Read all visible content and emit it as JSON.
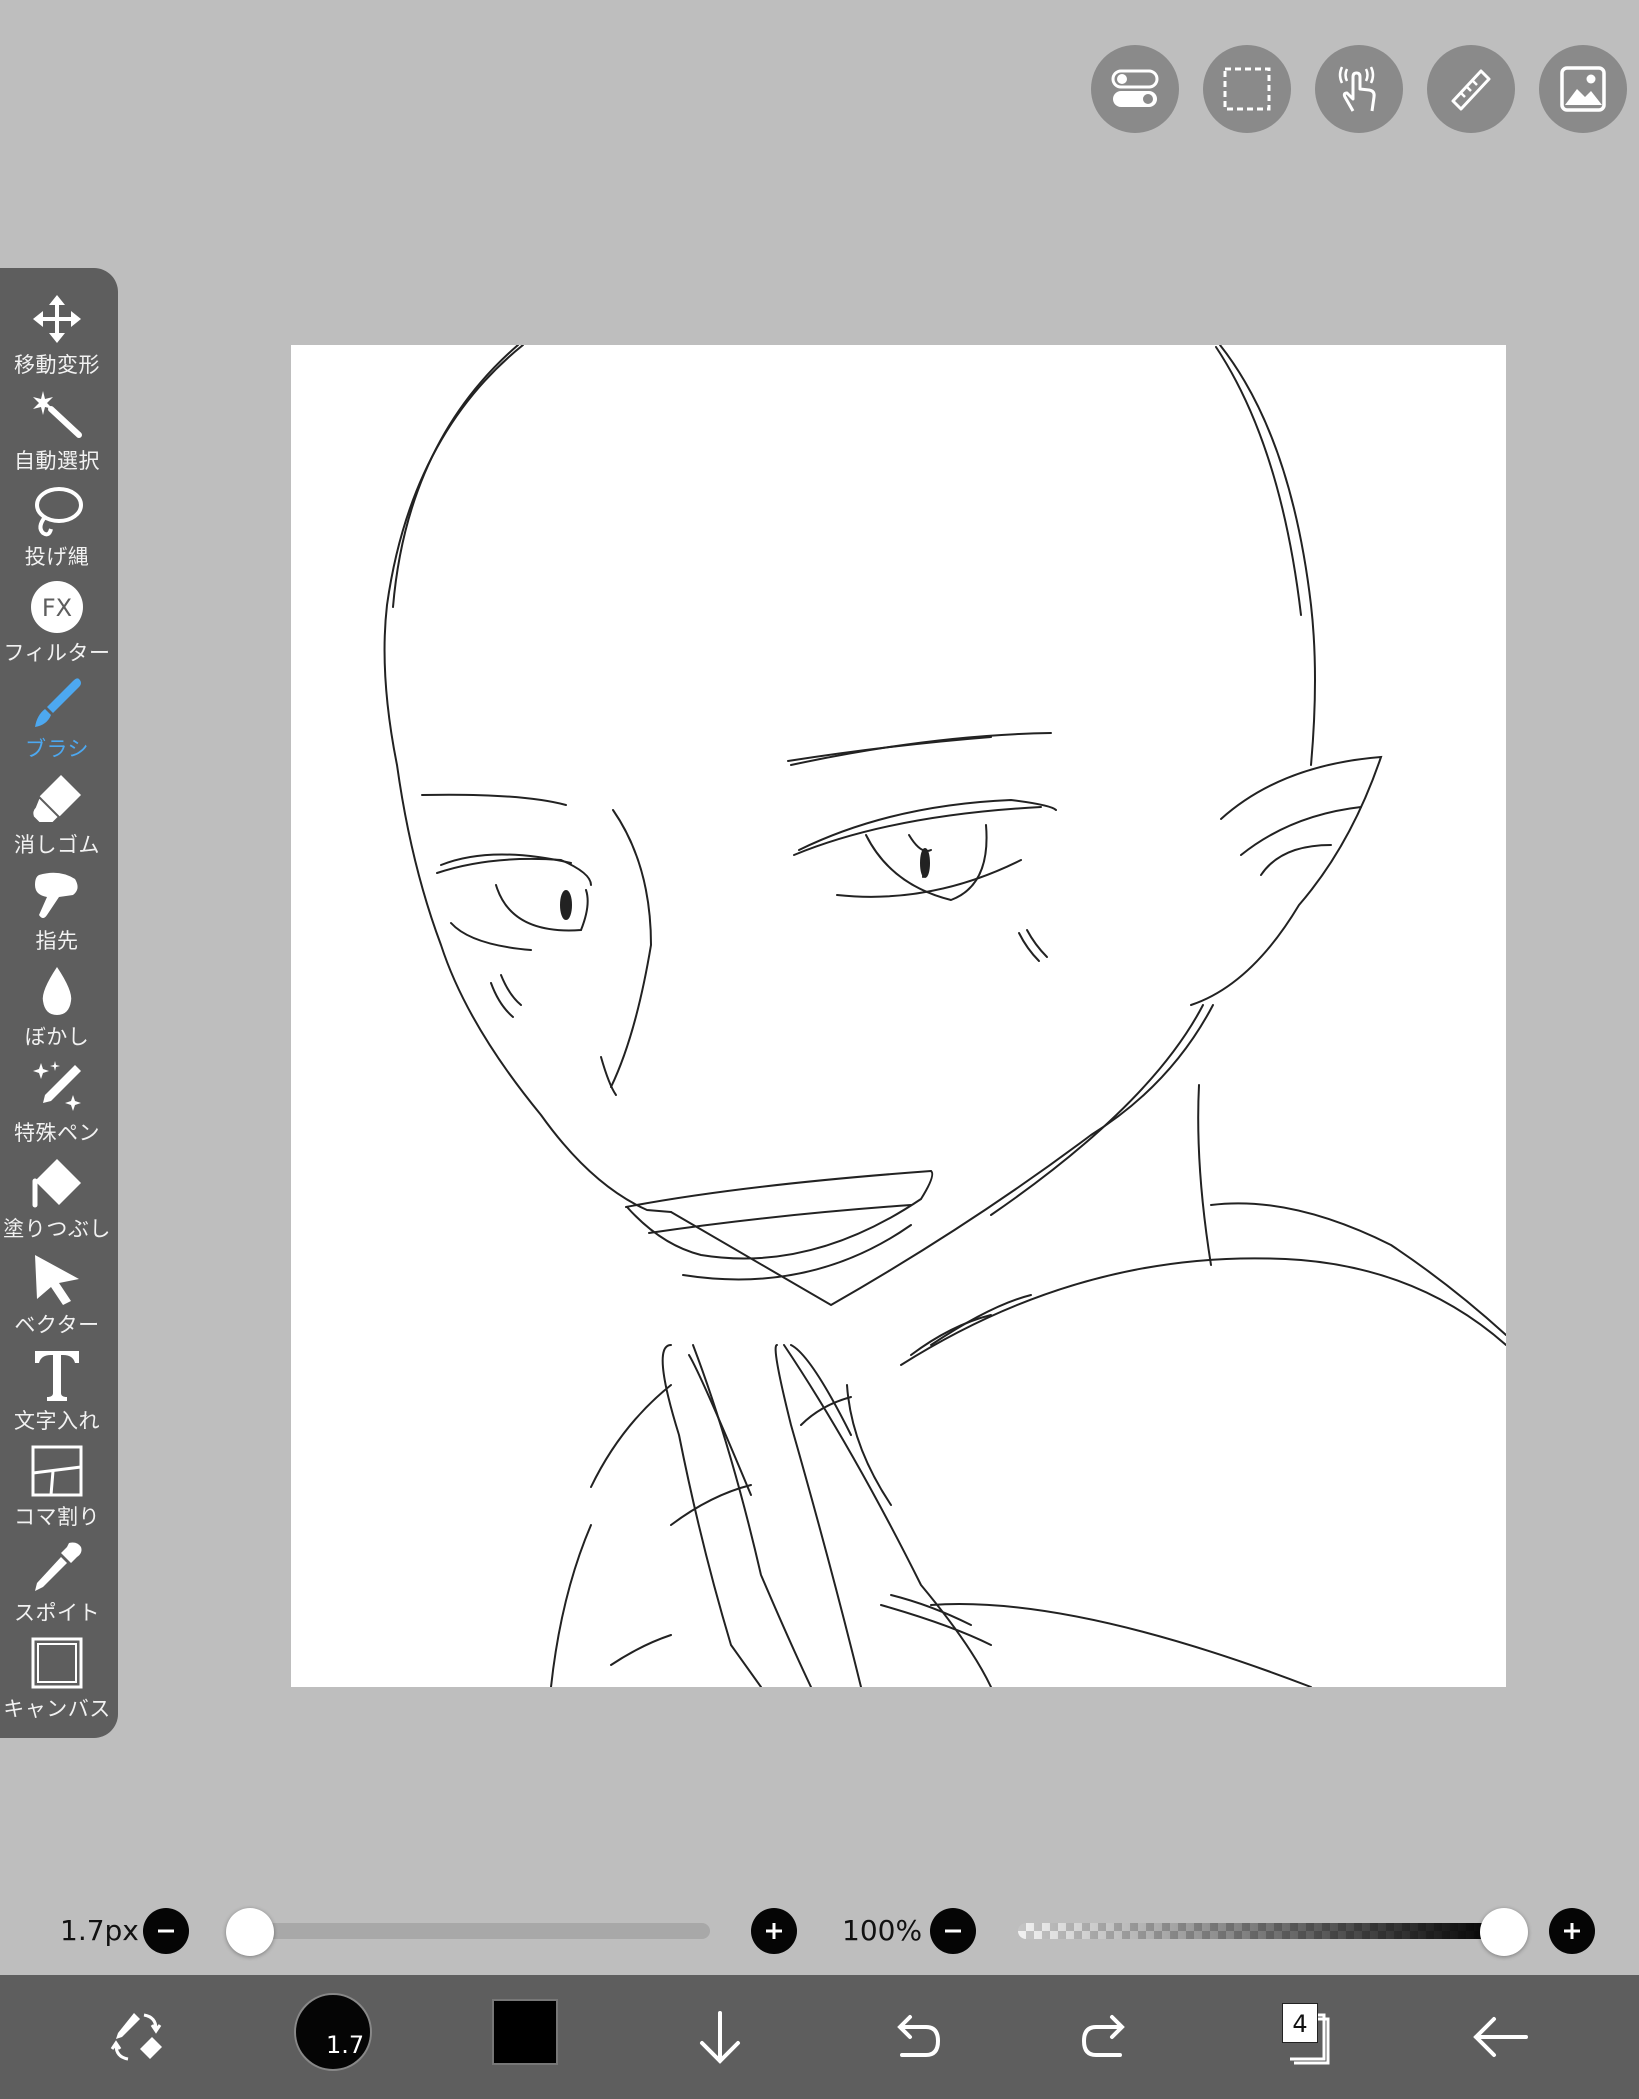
{
  "top_toolbar": {
    "buttons": [
      {
        "name": "toggle-icon"
      },
      {
        "name": "selection-icon"
      },
      {
        "name": "touch-gesture-icon"
      },
      {
        "name": "ruler-icon"
      },
      {
        "name": "image-icon"
      }
    ]
  },
  "toolbar": {
    "tools": [
      {
        "label": "移動変形",
        "icon": "move-transform-icon"
      },
      {
        "label": "自動選択",
        "icon": "magic-wand-icon"
      },
      {
        "label": "投げ縄",
        "icon": "lasso-icon"
      },
      {
        "label": "フィルター",
        "icon": "fx-filter-icon"
      },
      {
        "label": "ブラシ",
        "icon": "brush-icon",
        "active": true
      },
      {
        "label": "消しゴム",
        "icon": "eraser-icon"
      },
      {
        "label": "指先",
        "icon": "finger-smudge-icon"
      },
      {
        "label": "ぼかし",
        "icon": "blur-drop-icon"
      },
      {
        "label": "特殊ペン",
        "icon": "special-pen-icon"
      },
      {
        "label": "塗りつぶし",
        "icon": "fill-bucket-icon"
      },
      {
        "label": "ベクター",
        "icon": "vector-cursor-icon"
      },
      {
        "label": "文字入れ",
        "icon": "text-icon"
      },
      {
        "label": "コマ割り",
        "icon": "panel-split-icon"
      },
      {
        "label": "スポイト",
        "icon": "eyedropper-icon"
      },
      {
        "label": "キャンバス",
        "icon": "canvas-icon"
      }
    ],
    "filter_text": "FX"
  },
  "brush_size": {
    "value_label": "1.7px",
    "level": 0.03
  },
  "opacity": {
    "value_label": "100%",
    "level": 1.0
  },
  "bottom_bar": {
    "brush_size_label": "1.7",
    "current_color": "#000000",
    "layer_count": "4"
  },
  "colors": {
    "background": "#bebebe",
    "panel": "#5e5e5e",
    "accent": "#4da8f0",
    "button_gray": "#8a8a8a"
  }
}
